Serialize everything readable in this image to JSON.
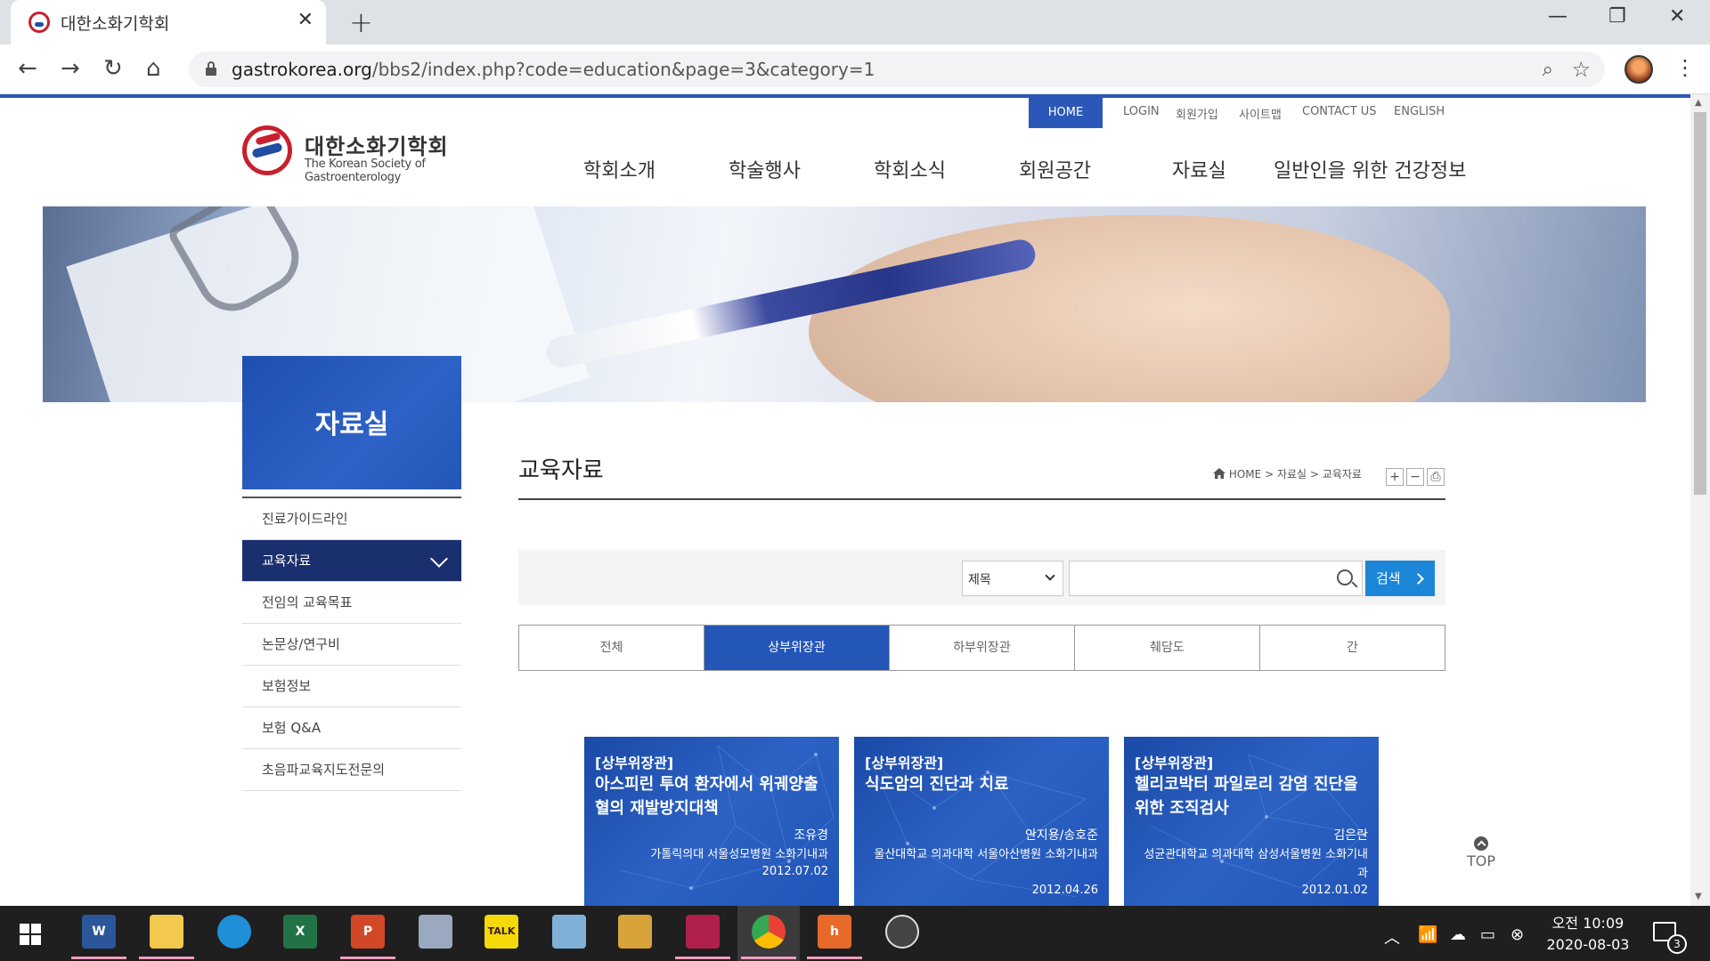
{
  "browser": {
    "tab_title": "대한소화기학회",
    "url_domain": "gastrokorea.org",
    "url_path": "/bbs2/index.php?code=education&page=3&category=1"
  },
  "site": {
    "utility": {
      "home": "HOME",
      "login": "LOGIN",
      "join": "회원가입",
      "sitemap": "사이트맵",
      "contact": "CONTACT US",
      "english": "ENGLISH"
    },
    "logo": {
      "ko": "대한소화기학회",
      "en": "The Korean Society of Gastroenterology"
    },
    "gnb": [
      "학회소개",
      "학술행사",
      "학회소식",
      "회원공간",
      "자료실",
      "일반인을 위한 건강정보"
    ]
  },
  "sidebar": {
    "title": "자료실",
    "items": [
      "진료가이드라인",
      "교육자료",
      "전임의 교육목표",
      "논문상/연구비",
      "보험정보",
      "보험 Q&A",
      "초음파교육지도전문의"
    ],
    "active_index": 1
  },
  "content": {
    "title": "교육자료",
    "breadcrumb": {
      "home": "HOME",
      "level1": "자료실",
      "level2": "교육자료"
    },
    "text_controls": [
      "+",
      "−",
      "⎙"
    ],
    "search": {
      "select_value": "제목",
      "input_value": "",
      "button": "검색"
    },
    "categories": [
      "전체",
      "상부위장관",
      "하부위장관",
      "췌담도",
      "간"
    ],
    "active_category_index": 1,
    "cards": [
      {
        "category": "[상부위장관]",
        "title": "아스피린 투여 환자에서 위궤양출혈의 재발방지대책",
        "author": "조유경",
        "org": "가톨릭의대 서울성모병원 소화기내과",
        "date": "2012.07.02"
      },
      {
        "category": "[상부위장관]",
        "title": "식도암의 진단과 치료",
        "author": "안지용/송호준",
        "org": "울산대학교 의과대학 서울아산병원 소화기내과",
        "date": "2012.04.26"
      },
      {
        "category": "[상부위장관]",
        "title": "헬리코박터 파일로리 감염 진단을 위한 조직검사",
        "author": "김은란",
        "org": "성균관대학교 의과대학 삼성서울병원 소화기내과",
        "date": "2012.01.02"
      }
    ],
    "top_button": "TOP"
  },
  "taskbar": {
    "apps": [
      {
        "name": "word",
        "label": "W",
        "color": "#2b579a",
        "running": true
      },
      {
        "name": "file-explorer",
        "label": "",
        "color": "#f2c94c",
        "running": true
      },
      {
        "name": "edge",
        "label": "",
        "color": "#1f8fd8",
        "running": false
      },
      {
        "name": "excel",
        "label": "X",
        "color": "#217346",
        "running": false
      },
      {
        "name": "powerpoint",
        "label": "P",
        "color": "#d24726",
        "running": true
      },
      {
        "name": "paint",
        "label": "",
        "color": "#9aa9c0",
        "running": false
      },
      {
        "name": "kakaotalk",
        "label": "TALK",
        "color": "#f5d90a",
        "running": false
      },
      {
        "name": "notepad",
        "label": "",
        "color": "#7fb1d8",
        "running": false
      },
      {
        "name": "connect",
        "label": "",
        "color": "#d8a23a",
        "running": false
      },
      {
        "name": "disk",
        "label": "",
        "color": "#b1204a",
        "running": true
      },
      {
        "name": "chrome",
        "label": "",
        "color": "#e94235",
        "running": true
      },
      {
        "name": "hwp",
        "label": "h",
        "color": "#e86a2a",
        "running": true
      },
      {
        "name": "obs",
        "label": "",
        "color": "#444444",
        "running": false
      }
    ],
    "clock": {
      "time": "오전 10:09",
      "date": "2020-08-03"
    },
    "notifications": "3"
  }
}
